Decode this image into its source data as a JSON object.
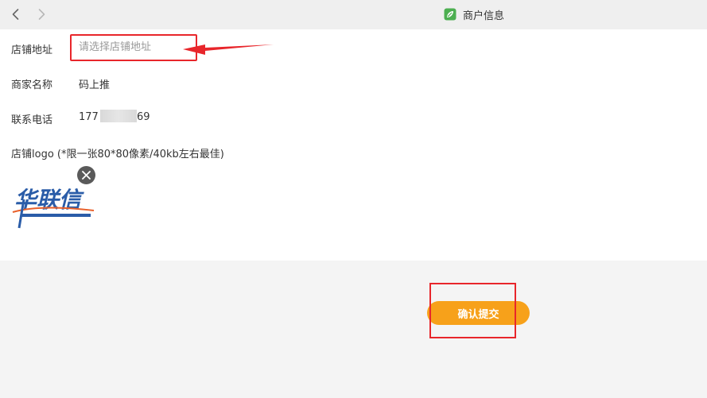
{
  "window": {
    "title": "商户信息",
    "app_icon": "leaf-app-icon"
  },
  "nav": {
    "back_icon": "chevron-left-icon",
    "forward_icon": "chevron-right-icon"
  },
  "form": {
    "address": {
      "label": "店铺地址",
      "placeholder": "请选择店铺地址",
      "value": ""
    },
    "merchant_name": {
      "label": "商家名称",
      "value": "码上推"
    },
    "phone": {
      "label": "联系电话",
      "value_prefix": "177",
      "value_suffix": "69"
    },
    "logo": {
      "label": "店铺logo (*限一张80*80像素/40kb左右最佳)",
      "logo_text": "华联信",
      "remove_icon": "close-icon"
    }
  },
  "actions": {
    "submit_label": "确认提交"
  },
  "colors": {
    "accent": "#f7a11a",
    "annotation": "#e8262b",
    "background": "#f4f4f4"
  }
}
